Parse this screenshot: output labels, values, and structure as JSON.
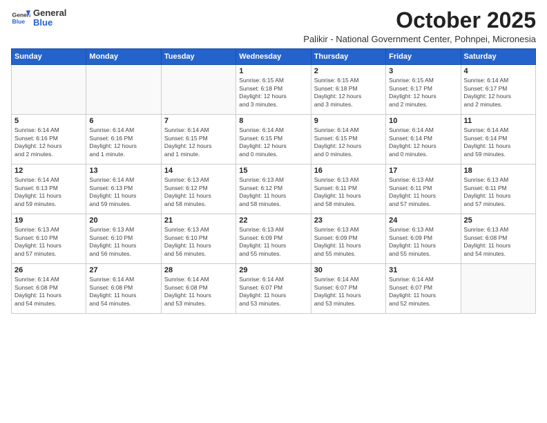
{
  "header": {
    "logo_general": "General",
    "logo_blue": "Blue",
    "month_title": "October 2025",
    "subtitle": "Palikir - National Government Center, Pohnpei, Micronesia"
  },
  "days_of_week": [
    "Sunday",
    "Monday",
    "Tuesday",
    "Wednesday",
    "Thursday",
    "Friday",
    "Saturday"
  ],
  "weeks": [
    [
      {
        "day": "",
        "info": ""
      },
      {
        "day": "",
        "info": ""
      },
      {
        "day": "",
        "info": ""
      },
      {
        "day": "1",
        "info": "Sunrise: 6:15 AM\nSunset: 6:18 PM\nDaylight: 12 hours\nand 3 minutes."
      },
      {
        "day": "2",
        "info": "Sunrise: 6:15 AM\nSunset: 6:18 PM\nDaylight: 12 hours\nand 3 minutes."
      },
      {
        "day": "3",
        "info": "Sunrise: 6:15 AM\nSunset: 6:17 PM\nDaylight: 12 hours\nand 2 minutes."
      },
      {
        "day": "4",
        "info": "Sunrise: 6:14 AM\nSunset: 6:17 PM\nDaylight: 12 hours\nand 2 minutes."
      }
    ],
    [
      {
        "day": "5",
        "info": "Sunrise: 6:14 AM\nSunset: 6:16 PM\nDaylight: 12 hours\nand 2 minutes."
      },
      {
        "day": "6",
        "info": "Sunrise: 6:14 AM\nSunset: 6:16 PM\nDaylight: 12 hours\nand 1 minute."
      },
      {
        "day": "7",
        "info": "Sunrise: 6:14 AM\nSunset: 6:15 PM\nDaylight: 12 hours\nand 1 minute."
      },
      {
        "day": "8",
        "info": "Sunrise: 6:14 AM\nSunset: 6:15 PM\nDaylight: 12 hours\nand 0 minutes."
      },
      {
        "day": "9",
        "info": "Sunrise: 6:14 AM\nSunset: 6:15 PM\nDaylight: 12 hours\nand 0 minutes."
      },
      {
        "day": "10",
        "info": "Sunrise: 6:14 AM\nSunset: 6:14 PM\nDaylight: 12 hours\nand 0 minutes."
      },
      {
        "day": "11",
        "info": "Sunrise: 6:14 AM\nSunset: 6:14 PM\nDaylight: 11 hours\nand 59 minutes."
      }
    ],
    [
      {
        "day": "12",
        "info": "Sunrise: 6:14 AM\nSunset: 6:13 PM\nDaylight: 11 hours\nand 59 minutes."
      },
      {
        "day": "13",
        "info": "Sunrise: 6:14 AM\nSunset: 6:13 PM\nDaylight: 11 hours\nand 59 minutes."
      },
      {
        "day": "14",
        "info": "Sunrise: 6:13 AM\nSunset: 6:12 PM\nDaylight: 11 hours\nand 58 minutes."
      },
      {
        "day": "15",
        "info": "Sunrise: 6:13 AM\nSunset: 6:12 PM\nDaylight: 11 hours\nand 58 minutes."
      },
      {
        "day": "16",
        "info": "Sunrise: 6:13 AM\nSunset: 6:11 PM\nDaylight: 11 hours\nand 58 minutes."
      },
      {
        "day": "17",
        "info": "Sunrise: 6:13 AM\nSunset: 6:11 PM\nDaylight: 11 hours\nand 57 minutes."
      },
      {
        "day": "18",
        "info": "Sunrise: 6:13 AM\nSunset: 6:11 PM\nDaylight: 11 hours\nand 57 minutes."
      }
    ],
    [
      {
        "day": "19",
        "info": "Sunrise: 6:13 AM\nSunset: 6:10 PM\nDaylight: 11 hours\nand 57 minutes."
      },
      {
        "day": "20",
        "info": "Sunrise: 6:13 AM\nSunset: 6:10 PM\nDaylight: 11 hours\nand 56 minutes."
      },
      {
        "day": "21",
        "info": "Sunrise: 6:13 AM\nSunset: 6:10 PM\nDaylight: 11 hours\nand 56 minutes."
      },
      {
        "day": "22",
        "info": "Sunrise: 6:13 AM\nSunset: 6:09 PM\nDaylight: 11 hours\nand 55 minutes."
      },
      {
        "day": "23",
        "info": "Sunrise: 6:13 AM\nSunset: 6:09 PM\nDaylight: 11 hours\nand 55 minutes."
      },
      {
        "day": "24",
        "info": "Sunrise: 6:13 AM\nSunset: 6:09 PM\nDaylight: 11 hours\nand 55 minutes."
      },
      {
        "day": "25",
        "info": "Sunrise: 6:13 AM\nSunset: 6:08 PM\nDaylight: 11 hours\nand 54 minutes."
      }
    ],
    [
      {
        "day": "26",
        "info": "Sunrise: 6:14 AM\nSunset: 6:08 PM\nDaylight: 11 hours\nand 54 minutes."
      },
      {
        "day": "27",
        "info": "Sunrise: 6:14 AM\nSunset: 6:08 PM\nDaylight: 11 hours\nand 54 minutes."
      },
      {
        "day": "28",
        "info": "Sunrise: 6:14 AM\nSunset: 6:08 PM\nDaylight: 11 hours\nand 53 minutes."
      },
      {
        "day": "29",
        "info": "Sunrise: 6:14 AM\nSunset: 6:07 PM\nDaylight: 11 hours\nand 53 minutes."
      },
      {
        "day": "30",
        "info": "Sunrise: 6:14 AM\nSunset: 6:07 PM\nDaylight: 11 hours\nand 53 minutes."
      },
      {
        "day": "31",
        "info": "Sunrise: 6:14 AM\nSunset: 6:07 PM\nDaylight: 11 hours\nand 52 minutes."
      },
      {
        "day": "",
        "info": ""
      }
    ]
  ]
}
